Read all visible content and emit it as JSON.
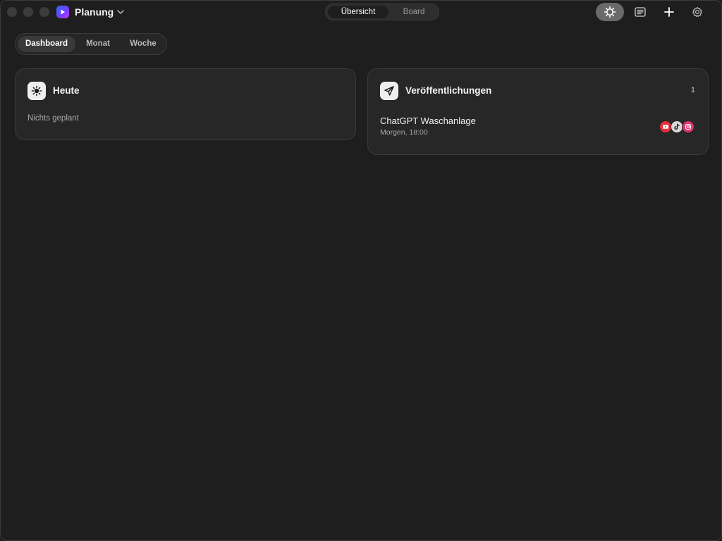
{
  "app": {
    "title": "Planung"
  },
  "top_tabs": [
    {
      "label": "Übersicht",
      "active": true
    },
    {
      "label": "Board",
      "active": false
    }
  ],
  "toolbar": {
    "icons": [
      "sun-icon",
      "list-icon",
      "plus-icon",
      "gear-icon"
    ]
  },
  "view_tabs": [
    {
      "label": "Dashboard",
      "active": true
    },
    {
      "label": "Monat",
      "active": false
    },
    {
      "label": "Woche",
      "active": false
    }
  ],
  "today": {
    "title": "Heute",
    "empty_text": "Nichts geplant",
    "icon": "sun-icon"
  },
  "publications": {
    "title": "Veröffentlichungen",
    "count": "1",
    "icon": "paper-plane-icon",
    "items": [
      {
        "title": "ChatGPT Waschanlage",
        "time": "Morgen, 18:00",
        "platforms": [
          "youtube-icon",
          "tiktok-icon",
          "instagram-icon"
        ]
      }
    ]
  },
  "colors": {
    "background": "#1e1e1e",
    "card": "#272727",
    "youtube": "#e5303a",
    "instagram": "#e2356a"
  }
}
